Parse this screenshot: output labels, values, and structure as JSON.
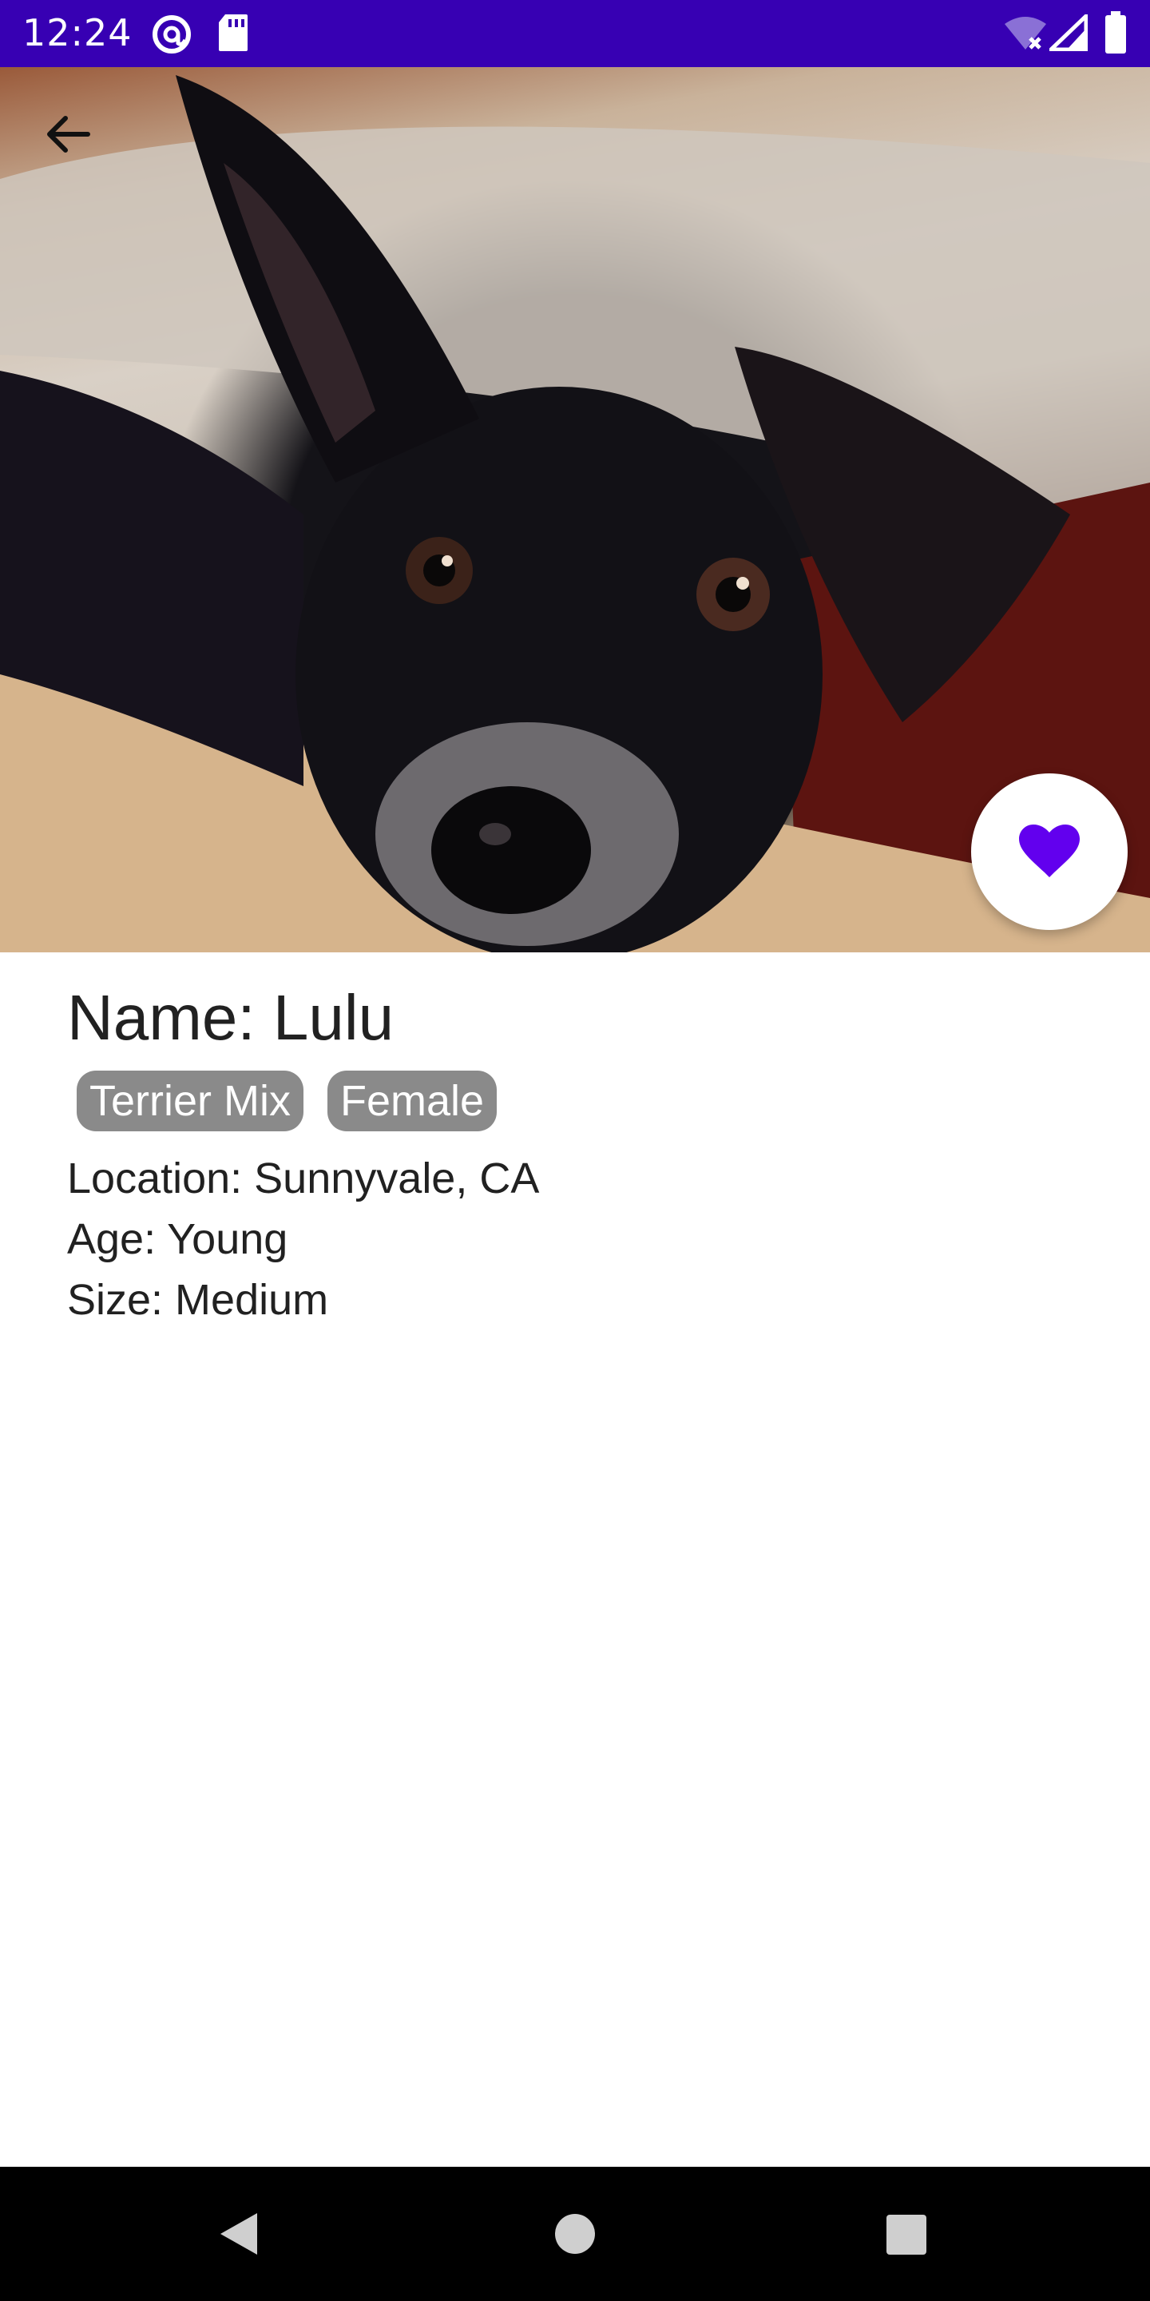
{
  "status_bar": {
    "time": "12:24",
    "icons": [
      "at-sign-icon",
      "sd-card-icon",
      "wifi-off-icon",
      "signal-icon",
      "battery-icon"
    ]
  },
  "hero": {
    "image": "dog-photo",
    "back_icon": "arrow-back-icon",
    "favorite_icon": "heart-icon",
    "favorite_color": "#6200ee"
  },
  "pet": {
    "name": "Name: Lulu",
    "tags": [
      "Terrier Mix",
      "Female"
    ],
    "location": "Location: Sunnyvale, CA",
    "age": "Age: Young",
    "size": "Size: Medium"
  },
  "nav_bar": {
    "icons": [
      "back-triangle-icon",
      "home-circle-icon",
      "recents-square-icon"
    ]
  },
  "colors": {
    "status_bar": "#3700b3",
    "chip_bg": "#8a8a8a",
    "text": "#212121"
  }
}
